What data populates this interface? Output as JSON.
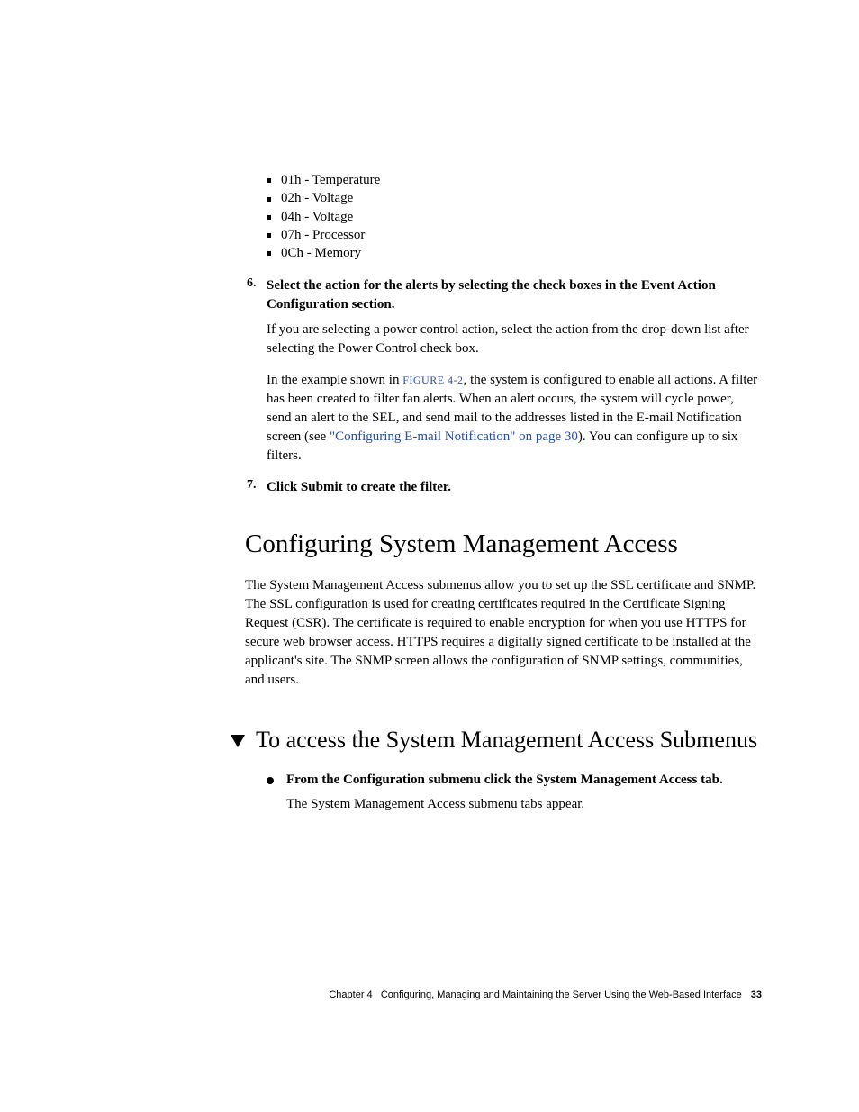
{
  "sensors": [
    "01h - Temperature",
    "02h - Voltage",
    "04h - Voltage",
    "07h - Processor",
    "0Ch - Memory"
  ],
  "step6": {
    "num": "6.",
    "title": "Select the action for the alerts by selecting the check boxes in the Event Action Configuration section.",
    "p1": "If you are selecting a power control action, select the action from the drop-down list after selecting the Power Control check box.",
    "p2a": "In the example shown in ",
    "fig": "FIGURE 4-2",
    "p2b": ", the system is configured to enable all actions. A filter has been created to filter fan alerts. When an alert occurs, the system will cycle power, send an alert to the SEL, and send mail to the addresses listed in the E-mail Notification screen (see ",
    "xref": "\"Configuring E-mail Notification\" on page 30",
    "p2c": "). You can configure up to six filters."
  },
  "step7": {
    "num": "7.",
    "title": "Click Submit to create the filter."
  },
  "sectionTitle": "Configuring System Management Access",
  "sectionBody": "The System Management Access submenus allow you to set up the SSL certificate and SNMP. The SSL configuration is used for creating certificates required in the Certificate Signing Request (CSR). The certificate is required to enable encryption for when you use HTTPS for secure web browser access. HTTPS requires a digitally signed certificate to be installed at the applicant's site. The SNMP screen allows the configuration of SNMP settings, communities, and users.",
  "procTitle": "To access the System Management Access Submenus",
  "procStep": {
    "title": "From the Configuration submenu click the System Management Access tab.",
    "body": "The System Management Access submenu tabs appear."
  },
  "footer": {
    "chapter": "Chapter 4",
    "title": "Configuring, Managing and Maintaining the Server Using the Web-Based Interface",
    "page": "33"
  }
}
